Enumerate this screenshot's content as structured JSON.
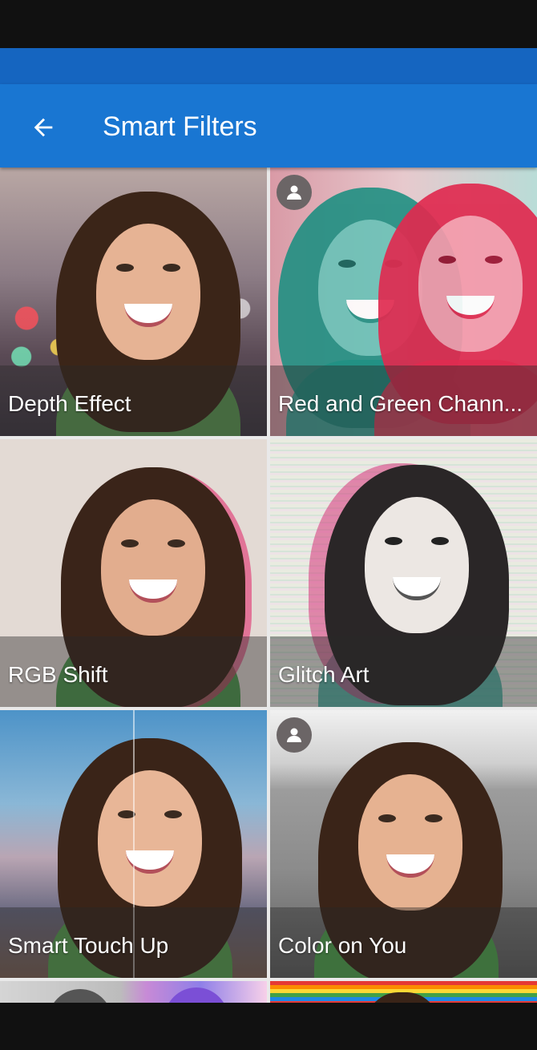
{
  "app_bar": {
    "title": "Smart Filters",
    "back_icon": "arrow-left-icon",
    "color": "#1976d2"
  },
  "filters": [
    {
      "label": "Depth Effect",
      "person_badge": false
    },
    {
      "label": "Red and Green Chann...",
      "person_badge": true
    },
    {
      "label": "RGB Shift",
      "person_badge": false
    },
    {
      "label": "Glitch Art",
      "person_badge": false
    },
    {
      "label": "Smart Touch Up",
      "person_badge": false
    },
    {
      "label": "Color on You",
      "person_badge": true
    }
  ],
  "badge_icon": "person-icon"
}
